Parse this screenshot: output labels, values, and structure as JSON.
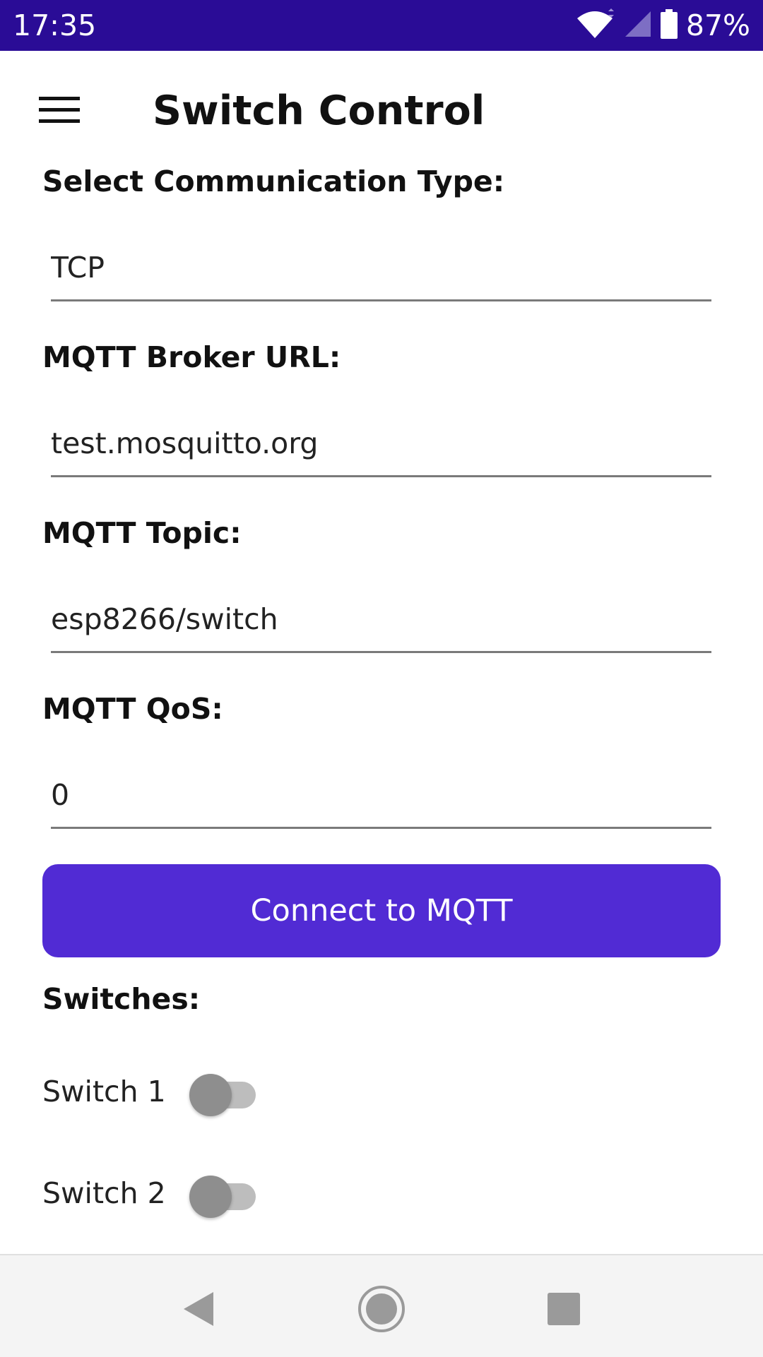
{
  "status_bar": {
    "time": "17:35",
    "battery_percent": "87%",
    "icons": [
      "wifi-icon",
      "signal-icon",
      "battery-icon"
    ]
  },
  "app_bar": {
    "title": "Switch Control",
    "menu_icon": "hamburger-menu-icon"
  },
  "form": {
    "communication_type_label": "Select Communication Type:",
    "communication_type_value": "TCP",
    "broker_url_label": "MQTT Broker URL:",
    "broker_url_value": "test.mosquitto.org",
    "topic_label": "MQTT Topic:",
    "topic_value": "esp8266/switch",
    "qos_label": "MQTT QoS:",
    "qos_value": "0",
    "connect_button_label": "Connect to MQTT"
  },
  "switches": {
    "heading": "Switches:",
    "items": [
      {
        "label": "Switch 1",
        "on": false
      },
      {
        "label": "Switch 2",
        "on": false
      }
    ]
  },
  "nav_bar": {
    "icons": [
      "back-icon",
      "home-icon",
      "recents-icon"
    ]
  },
  "colors": {
    "status_bar": "#2a0c96",
    "primary": "#512bd4",
    "toggle_off_thumb": "#8e8e8e",
    "toggle_off_track": "#bdbdbd"
  }
}
